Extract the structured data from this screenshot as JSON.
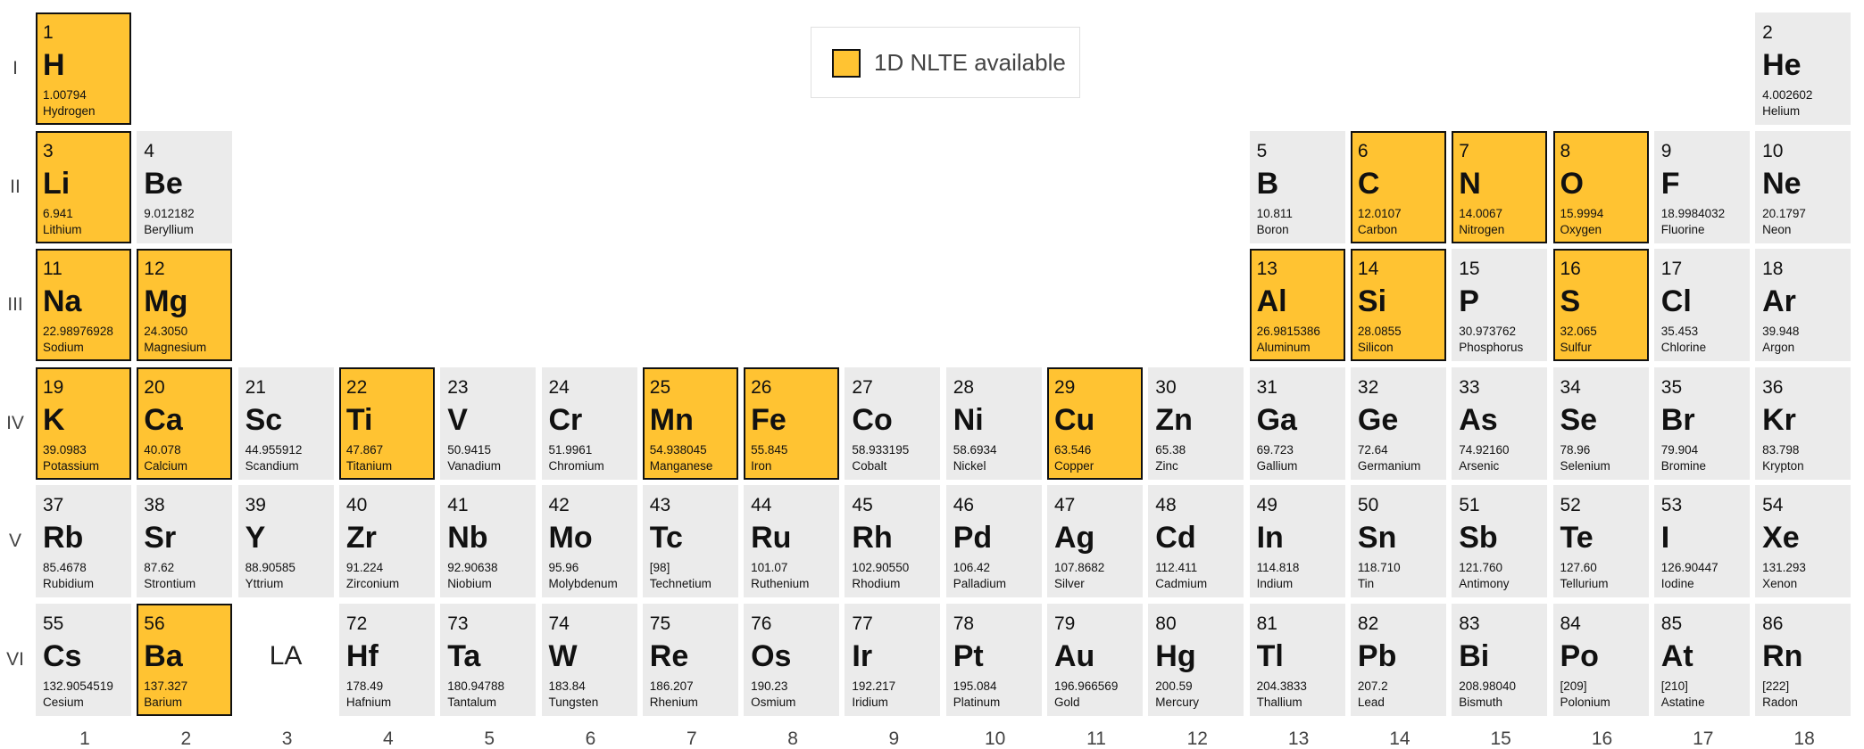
{
  "legend": {
    "label": "1D NLTE available",
    "color": "#ffc332"
  },
  "colors": {
    "available": "#ffc332",
    "unavailable": "#ebebeb",
    "border": "#111111"
  },
  "period_labels": [
    "I",
    "II",
    "III",
    "IV",
    "V",
    "VI"
  ],
  "group_labels": [
    "1",
    "2",
    "3",
    "4",
    "5",
    "6",
    "7",
    "8",
    "9",
    "10",
    "11",
    "12",
    "13",
    "14",
    "15",
    "16",
    "17",
    "18"
  ],
  "lanthanide_placeholder": "LA",
  "elements": [
    {
      "num": "1",
      "sym": "H",
      "mass": "1.00794",
      "name": "Hydrogen",
      "period": 1,
      "group": 1,
      "nlte": true
    },
    {
      "num": "2",
      "sym": "He",
      "mass": "4.002602",
      "name": "Helium",
      "period": 1,
      "group": 18,
      "nlte": false
    },
    {
      "num": "3",
      "sym": "Li",
      "mass": "6.941",
      "name": "Lithium",
      "period": 2,
      "group": 1,
      "nlte": true
    },
    {
      "num": "4",
      "sym": "Be",
      "mass": "9.012182",
      "name": "Beryllium",
      "period": 2,
      "group": 2,
      "nlte": false
    },
    {
      "num": "5",
      "sym": "B",
      "mass": "10.811",
      "name": "Boron",
      "period": 2,
      "group": 13,
      "nlte": false
    },
    {
      "num": "6",
      "sym": "C",
      "mass": "12.0107",
      "name": "Carbon",
      "period": 2,
      "group": 14,
      "nlte": true
    },
    {
      "num": "7",
      "sym": "N",
      "mass": "14.0067",
      "name": "Nitrogen",
      "period": 2,
      "group": 15,
      "nlte": true
    },
    {
      "num": "8",
      "sym": "O",
      "mass": "15.9994",
      "name": "Oxygen",
      "period": 2,
      "group": 16,
      "nlte": true
    },
    {
      "num": "9",
      "sym": "F",
      "mass": "18.9984032",
      "name": "Fluorine",
      "period": 2,
      "group": 17,
      "nlte": false
    },
    {
      "num": "10",
      "sym": "Ne",
      "mass": "20.1797",
      "name": "Neon",
      "period": 2,
      "group": 18,
      "nlte": false
    },
    {
      "num": "11",
      "sym": "Na",
      "mass": "22.98976928",
      "name": "Sodium",
      "period": 3,
      "group": 1,
      "nlte": true
    },
    {
      "num": "12",
      "sym": "Mg",
      "mass": "24.3050",
      "name": "Magnesium",
      "period": 3,
      "group": 2,
      "nlte": true
    },
    {
      "num": "13",
      "sym": "Al",
      "mass": "26.9815386",
      "name": "Aluminum",
      "period": 3,
      "group": 13,
      "nlte": true
    },
    {
      "num": "14",
      "sym": "Si",
      "mass": "28.0855",
      "name": "Silicon",
      "period": 3,
      "group": 14,
      "nlte": true
    },
    {
      "num": "15",
      "sym": "P",
      "mass": "30.973762",
      "name": "Phosphorus",
      "period": 3,
      "group": 15,
      "nlte": false
    },
    {
      "num": "16",
      "sym": "S",
      "mass": "32.065",
      "name": "Sulfur",
      "period": 3,
      "group": 16,
      "nlte": true
    },
    {
      "num": "17",
      "sym": "Cl",
      "mass": "35.453",
      "name": "Chlorine",
      "period": 3,
      "group": 17,
      "nlte": false
    },
    {
      "num": "18",
      "sym": "Ar",
      "mass": "39.948",
      "name": "Argon",
      "period": 3,
      "group": 18,
      "nlte": false
    },
    {
      "num": "19",
      "sym": "K",
      "mass": "39.0983",
      "name": "Potassium",
      "period": 4,
      "group": 1,
      "nlte": true
    },
    {
      "num": "20",
      "sym": "Ca",
      "mass": "40.078",
      "name": "Calcium",
      "period": 4,
      "group": 2,
      "nlte": true
    },
    {
      "num": "21",
      "sym": "Sc",
      "mass": "44.955912",
      "name": "Scandium",
      "period": 4,
      "group": 3,
      "nlte": false
    },
    {
      "num": "22",
      "sym": "Ti",
      "mass": "47.867",
      "name": "Titanium",
      "period": 4,
      "group": 4,
      "nlte": true
    },
    {
      "num": "23",
      "sym": "V",
      "mass": "50.9415",
      "name": "Vanadium",
      "period": 4,
      "group": 5,
      "nlte": false
    },
    {
      "num": "24",
      "sym": "Cr",
      "mass": "51.9961",
      "name": "Chromium",
      "period": 4,
      "group": 6,
      "nlte": false
    },
    {
      "num": "25",
      "sym": "Mn",
      "mass": "54.938045",
      "name": "Manganese",
      "period": 4,
      "group": 7,
      "nlte": true
    },
    {
      "num": "26",
      "sym": "Fe",
      "mass": "55.845",
      "name": "Iron",
      "period": 4,
      "group": 8,
      "nlte": true
    },
    {
      "num": "27",
      "sym": "Co",
      "mass": "58.933195",
      "name": "Cobalt",
      "period": 4,
      "group": 9,
      "nlte": false
    },
    {
      "num": "28",
      "sym": "Ni",
      "mass": "58.6934",
      "name": "Nickel",
      "period": 4,
      "group": 10,
      "nlte": false
    },
    {
      "num": "29",
      "sym": "Cu",
      "mass": "63.546",
      "name": "Copper",
      "period": 4,
      "group": 11,
      "nlte": true
    },
    {
      "num": "30",
      "sym": "Zn",
      "mass": "65.38",
      "name": "Zinc",
      "period": 4,
      "group": 12,
      "nlte": false
    },
    {
      "num": "31",
      "sym": "Ga",
      "mass": "69.723",
      "name": "Gallium",
      "period": 4,
      "group": 13,
      "nlte": false
    },
    {
      "num": "32",
      "sym": "Ge",
      "mass": "72.64",
      "name": "Germanium",
      "period": 4,
      "group": 14,
      "nlte": false
    },
    {
      "num": "33",
      "sym": "As",
      "mass": "74.92160",
      "name": "Arsenic",
      "period": 4,
      "group": 15,
      "nlte": false
    },
    {
      "num": "34",
      "sym": "Se",
      "mass": "78.96",
      "name": "Selenium",
      "period": 4,
      "group": 16,
      "nlte": false
    },
    {
      "num": "35",
      "sym": "Br",
      "mass": "79.904",
      "name": "Bromine",
      "period": 4,
      "group": 17,
      "nlte": false
    },
    {
      "num": "36",
      "sym": "Kr",
      "mass": "83.798",
      "name": "Krypton",
      "period": 4,
      "group": 18,
      "nlte": false
    },
    {
      "num": "37",
      "sym": "Rb",
      "mass": "85.4678",
      "name": "Rubidium",
      "period": 5,
      "group": 1,
      "nlte": false
    },
    {
      "num": "38",
      "sym": "Sr",
      "mass": "87.62",
      "name": "Strontium",
      "period": 5,
      "group": 2,
      "nlte": false
    },
    {
      "num": "39",
      "sym": "Y",
      "mass": "88.90585",
      "name": "Yttrium",
      "period": 5,
      "group": 3,
      "nlte": false
    },
    {
      "num": "40",
      "sym": "Zr",
      "mass": "91.224",
      "name": "Zirconium",
      "period": 5,
      "group": 4,
      "nlte": false
    },
    {
      "num": "41",
      "sym": "Nb",
      "mass": "92.90638",
      "name": "Niobium",
      "period": 5,
      "group": 5,
      "nlte": false
    },
    {
      "num": "42",
      "sym": "Mo",
      "mass": "95.96",
      "name": "Molybdenum",
      "period": 5,
      "group": 6,
      "nlte": false
    },
    {
      "num": "43",
      "sym": "Tc",
      "mass": "[98]",
      "name": "Technetium",
      "period": 5,
      "group": 7,
      "nlte": false
    },
    {
      "num": "44",
      "sym": "Ru",
      "mass": "101.07",
      "name": "Ruthenium",
      "period": 5,
      "group": 8,
      "nlte": false
    },
    {
      "num": "45",
      "sym": "Rh",
      "mass": "102.90550",
      "name": "Rhodium",
      "period": 5,
      "group": 9,
      "nlte": false
    },
    {
      "num": "46",
      "sym": "Pd",
      "mass": "106.42",
      "name": "Palladium",
      "period": 5,
      "group": 10,
      "nlte": false
    },
    {
      "num": "47",
      "sym": "Ag",
      "mass": "107.8682",
      "name": "Silver",
      "period": 5,
      "group": 11,
      "nlte": false
    },
    {
      "num": "48",
      "sym": "Cd",
      "mass": "112.411",
      "name": "Cadmium",
      "period": 5,
      "group": 12,
      "nlte": false
    },
    {
      "num": "49",
      "sym": "In",
      "mass": "114.818",
      "name": "Indium",
      "period": 5,
      "group": 13,
      "nlte": false
    },
    {
      "num": "50",
      "sym": "Sn",
      "mass": "118.710",
      "name": "Tin",
      "period": 5,
      "group": 14,
      "nlte": false
    },
    {
      "num": "51",
      "sym": "Sb",
      "mass": "121.760",
      "name": "Antimony",
      "period": 5,
      "group": 15,
      "nlte": false
    },
    {
      "num": "52",
      "sym": "Te",
      "mass": "127.60",
      "name": "Tellurium",
      "period": 5,
      "group": 16,
      "nlte": false
    },
    {
      "num": "53",
      "sym": "I",
      "mass": "126.90447",
      "name": "Iodine",
      "period": 5,
      "group": 17,
      "nlte": false
    },
    {
      "num": "54",
      "sym": "Xe",
      "mass": "131.293",
      "name": "Xenon",
      "period": 5,
      "group": 18,
      "nlte": false
    },
    {
      "num": "55",
      "sym": "Cs",
      "mass": "132.9054519",
      "name": "Cesium",
      "period": 6,
      "group": 1,
      "nlte": false
    },
    {
      "num": "56",
      "sym": "Ba",
      "mass": "137.327",
      "name": "Barium",
      "period": 6,
      "group": 2,
      "nlte": true
    },
    {
      "num": "72",
      "sym": "Hf",
      "mass": "178.49",
      "name": "Hafnium",
      "period": 6,
      "group": 4,
      "nlte": false
    },
    {
      "num": "73",
      "sym": "Ta",
      "mass": "180.94788",
      "name": "Tantalum",
      "period": 6,
      "group": 5,
      "nlte": false
    },
    {
      "num": "74",
      "sym": "W",
      "mass": "183.84",
      "name": "Tungsten",
      "period": 6,
      "group": 6,
      "nlte": false
    },
    {
      "num": "75",
      "sym": "Re",
      "mass": "186.207",
      "name": "Rhenium",
      "period": 6,
      "group": 7,
      "nlte": false
    },
    {
      "num": "76",
      "sym": "Os",
      "mass": "190.23",
      "name": "Osmium",
      "period": 6,
      "group": 8,
      "nlte": false
    },
    {
      "num": "77",
      "sym": "Ir",
      "mass": "192.217",
      "name": "Iridium",
      "period": 6,
      "group": 9,
      "nlte": false
    },
    {
      "num": "78",
      "sym": "Pt",
      "mass": "195.084",
      "name": "Platinum",
      "period": 6,
      "group": 10,
      "nlte": false
    },
    {
      "num": "79",
      "sym": "Au",
      "mass": "196.966569",
      "name": "Gold",
      "period": 6,
      "group": 11,
      "nlte": false
    },
    {
      "num": "80",
      "sym": "Hg",
      "mass": "200.59",
      "name": "Mercury",
      "period": 6,
      "group": 12,
      "nlte": false
    },
    {
      "num": "81",
      "sym": "Tl",
      "mass": "204.3833",
      "name": "Thallium",
      "period": 6,
      "group": 13,
      "nlte": false
    },
    {
      "num": "82",
      "sym": "Pb",
      "mass": "207.2",
      "name": "Lead",
      "period": 6,
      "group": 14,
      "nlte": false
    },
    {
      "num": "83",
      "sym": "Bi",
      "mass": "208.98040",
      "name": "Bismuth",
      "period": 6,
      "group": 15,
      "nlte": false
    },
    {
      "num": "84",
      "sym": "Po",
      "mass": "[209]",
      "name": "Polonium",
      "period": 6,
      "group": 16,
      "nlte": false
    },
    {
      "num": "85",
      "sym": "At",
      "mass": "[210]",
      "name": "Astatine",
      "period": 6,
      "group": 17,
      "nlte": false
    },
    {
      "num": "86",
      "sym": "Rn",
      "mass": "[222]",
      "name": "Radon",
      "period": 6,
      "group": 18,
      "nlte": false
    }
  ]
}
